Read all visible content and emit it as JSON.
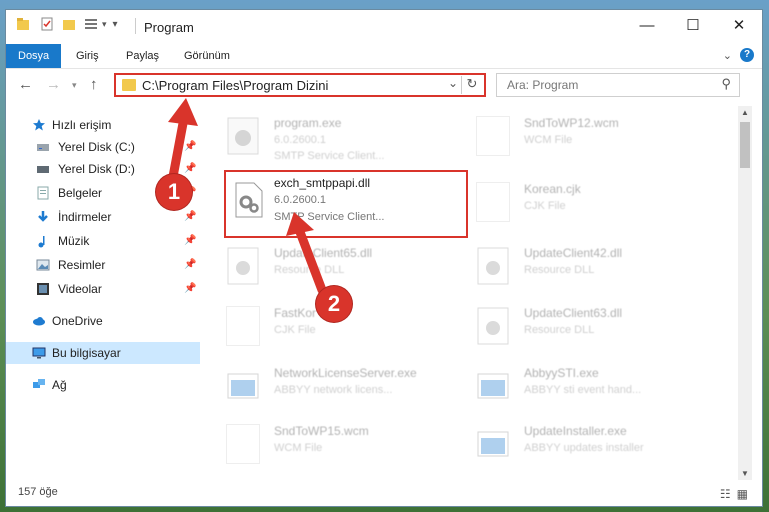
{
  "window": {
    "title": "Program",
    "minimize_glyph": "—",
    "maximize_glyph": "☐",
    "close_glyph": "✕"
  },
  "ribbon": {
    "tabs": [
      "Dosya",
      "Giriş",
      "Paylaş",
      "Görünüm"
    ],
    "help_glyph": "?"
  },
  "address_bar": {
    "path": "C:\\Program Files\\Program Dizini"
  },
  "search": {
    "placeholder": "Ara: Program"
  },
  "sidebar": {
    "items": [
      {
        "label": "Hızlı erişim",
        "icon": "star-icon",
        "pinned": false,
        "selected": false
      },
      {
        "label": "Yerel Disk (C:)",
        "icon": "drive-icon",
        "pinned": true,
        "selected": false
      },
      {
        "label": "Yerel Disk (D:)",
        "icon": "drive-icon",
        "pinned": true,
        "selected": false
      },
      {
        "label": "Belgeler",
        "icon": "documents-icon",
        "pinned": true,
        "selected": false
      },
      {
        "label": "İndirmeler",
        "icon": "download-icon",
        "pinned": true,
        "selected": false
      },
      {
        "label": "Müzik",
        "icon": "music-icon",
        "pinned": true,
        "selected": false
      },
      {
        "label": "Resimler",
        "icon": "pictures-icon",
        "pinned": true,
        "selected": false
      },
      {
        "label": "Videolar",
        "icon": "videos-icon",
        "pinned": true,
        "selected": false
      },
      {
        "label": "OneDrive",
        "icon": "cloud-icon",
        "pinned": false,
        "selected": false
      },
      {
        "label": "Bu bilgisayar",
        "icon": "computer-icon",
        "pinned": false,
        "selected": true
      },
      {
        "label": "Ağ",
        "icon": "network-icon",
        "pinned": false,
        "selected": false
      }
    ]
  },
  "files": [
    {
      "name": "program.exe",
      "line2": "6.0.2600.1",
      "line3": "SMTP Service Client...",
      "icon": "exe-gear-icon"
    },
    {
      "name": "SndToWP12.wcm",
      "line2": "WCM File",
      "line3": "",
      "icon": "blank-file-icon"
    },
    {
      "name": "exch_smtppapi.dll",
      "line2": "6.0.2600.1",
      "line3": "SMTP Service Client...",
      "icon": "dll-gear-icon"
    },
    {
      "name": "Korean.cjk",
      "line2": "CJK File",
      "line3": "",
      "icon": "blank-file-icon"
    },
    {
      "name": "UpdateClient65.dll",
      "line2": "Resource DLL",
      "line3": "",
      "icon": "dll-gear-icon"
    },
    {
      "name": "UpdateClient42.dll",
      "line2": "Resource DLL",
      "line3": "",
      "icon": "dll-gear-icon"
    },
    {
      "name": "FastKor",
      "line2": "CJK File",
      "line3": "",
      "icon": "blank-file-icon"
    },
    {
      "name": "UpdateClient63.dll",
      "line2": "Resource DLL",
      "line3": "",
      "icon": "dll-gear-icon"
    },
    {
      "name": "NetworkLicenseServer.exe",
      "line2": "ABBYY network licens...",
      "line3": "",
      "icon": "exe-window-icon"
    },
    {
      "name": "AbbyySTI.exe",
      "line2": "ABBYY sti event hand...",
      "line3": "",
      "icon": "exe-window-icon"
    },
    {
      "name": "SndToWP15.wcm",
      "line2": "WCM File",
      "line3": "",
      "icon": "blank-file-icon"
    },
    {
      "name": "UpdateInstaller.exe",
      "line2": "ABBYY updates installer",
      "line3": "",
      "icon": "exe-window-icon"
    }
  ],
  "status": {
    "count": "157 öğe"
  },
  "annotations": [
    "1",
    "2"
  ]
}
